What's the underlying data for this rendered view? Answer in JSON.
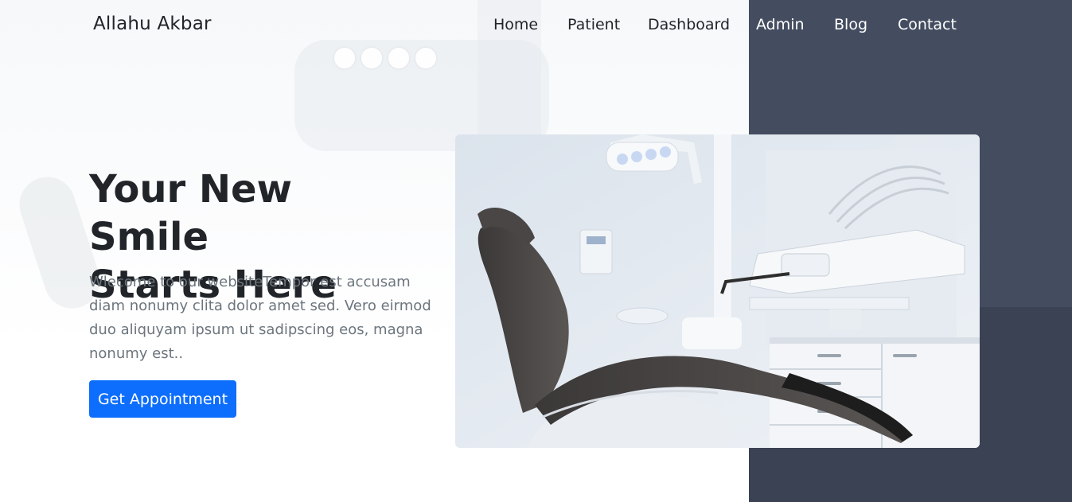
{
  "brand": "Allahu Akbar",
  "nav": {
    "items": [
      {
        "label": "Home"
      },
      {
        "label": "Patient"
      },
      {
        "label": "Dashboard"
      },
      {
        "label": "Admin"
      },
      {
        "label": "Blog"
      },
      {
        "label": "Contact"
      }
    ]
  },
  "hero": {
    "title_line1": "Your New Smile",
    "title_line2": "Starts Here",
    "description": "Wlecome to our websiteTempor est accusam diam nonumy clita dolor amet sed. Vero eirmod duo aliquyam ipsum ut sadipscing eos, magna nonumy est..",
    "button_label": "Get Appointment",
    "image_subject": "dental-chair-photo"
  },
  "colors": {
    "primary": "#0d6efd",
    "dark_panel": "#3a4254",
    "heading": "#212529",
    "muted_text": "#6c757d"
  }
}
